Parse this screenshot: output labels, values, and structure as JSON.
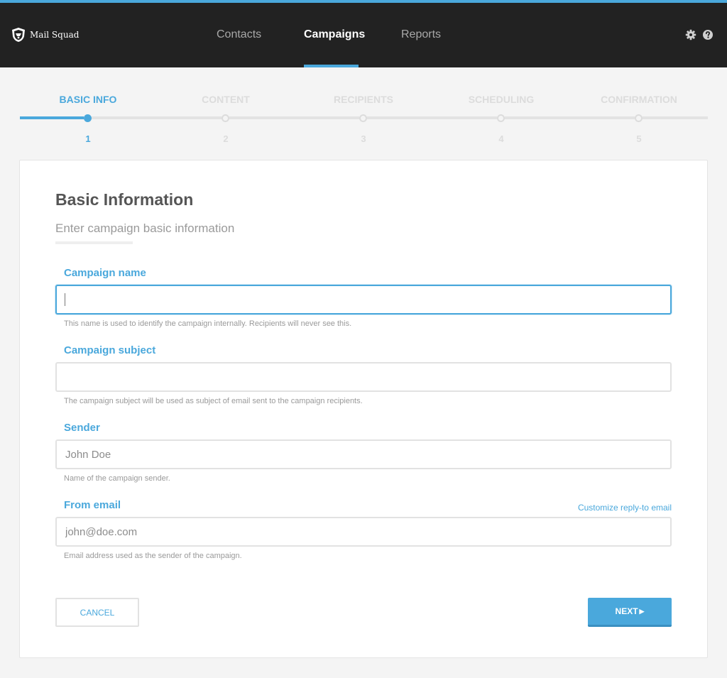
{
  "app": {
    "brand": "Mail Squad",
    "accent_color": "#4aa8dc",
    "nav_background": "#222222"
  },
  "nav": {
    "items": [
      {
        "label": "Contacts",
        "active": false
      },
      {
        "label": "Campaigns",
        "active": true
      },
      {
        "label": "Reports",
        "active": false
      }
    ],
    "icons": [
      "gear-icon",
      "help-icon"
    ]
  },
  "wizard": {
    "current_step": 1,
    "steps": [
      {
        "label": "BASIC INFO",
        "number": "1"
      },
      {
        "label": "CONTENT",
        "number": "2"
      },
      {
        "label": "RECIPIENTS",
        "number": "3"
      },
      {
        "label": "SCHEDULING",
        "number": "4"
      },
      {
        "label": "CONFIRMATION",
        "number": "5"
      }
    ]
  },
  "form": {
    "title": "Basic Information",
    "subtitle": "Enter campaign basic information",
    "fields": [
      {
        "label": "Campaign name",
        "value": "",
        "placeholder": "",
        "help": "This name is used to identify the campaign internally. Recipients will never see this."
      },
      {
        "label": "Campaign subject",
        "value": "",
        "placeholder": "",
        "help": "The campaign subject will be used as subject of email sent to the campaign recipients."
      },
      {
        "label": "Sender",
        "value": "",
        "placeholder": "John Doe",
        "help": "Name of the campaign sender."
      },
      {
        "label": "From email",
        "value": "",
        "placeholder": "john@doe.com",
        "help": "Email address used as the sender of the campaign."
      }
    ],
    "reply_to_link": "Customize reply-to email",
    "cancel_label": "CANCEL",
    "next_label": "NEXT",
    "next_icon": "caret-right-icon"
  }
}
